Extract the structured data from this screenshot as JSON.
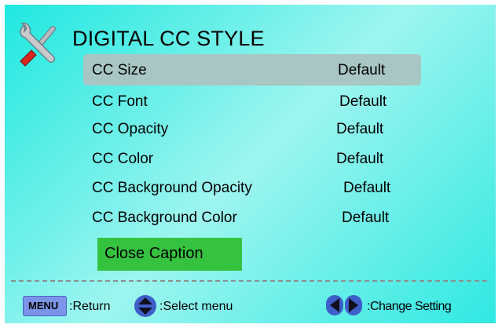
{
  "title": "DIGITAL CC STYLE",
  "icon": "tools-icon",
  "menu_items": [
    {
      "label": "CC Size",
      "value": "Default",
      "selected": true
    },
    {
      "label": "CC Font",
      "value": "Default",
      "selected": false
    },
    {
      "label": "CC Opacity",
      "value": "Default",
      "selected": false
    },
    {
      "label": "CC Color",
      "value": "Default",
      "selected": false
    },
    {
      "label": "CC Background Opacity",
      "value": "Default",
      "selected": false
    },
    {
      "label": "CC Background Color",
      "value": "Default",
      "selected": false
    }
  ],
  "close_caption_label": "Close Caption",
  "footer": {
    "menu_key": "MENU",
    "return_label": ":Return",
    "select_label": ":Select menu",
    "change_label": ":Change Setting"
  },
  "colors": {
    "background": "#2fe9e2",
    "selected_row": "#a8c6c4",
    "close_caption_bg": "#35c33f",
    "key_blue": "#4169e1"
  }
}
